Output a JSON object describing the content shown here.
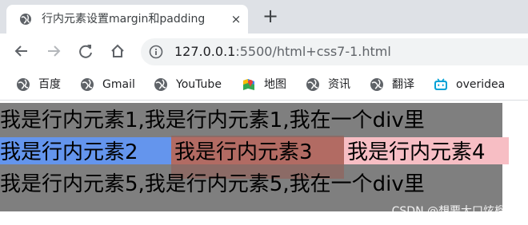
{
  "tab": {
    "title": "行内元素设置margin和padding",
    "close_glyph": "×"
  },
  "newtab_glyph": "+",
  "address_bar": {
    "host": "127.0.0.1",
    "rest": ":5500/html+css7-1.html"
  },
  "bookmarks": [
    {
      "label": "百度",
      "icon": "globe-icon"
    },
    {
      "label": "Gmail",
      "icon": "globe-icon"
    },
    {
      "label": "YouTube",
      "icon": "globe-icon"
    },
    {
      "label": "地图",
      "icon": "maps-icon"
    },
    {
      "label": "资讯",
      "icon": "globe-icon"
    },
    {
      "label": "翻译",
      "icon": "globe-icon"
    },
    {
      "label": "overidea",
      "icon": "bilibili-icon"
    }
  ],
  "page": {
    "line1": "我是行内元素1,我是行内元素1,我在一个div里",
    "span2": "我是行内元素2",
    "span3": "我是行内元素3",
    "span4": "我是行内元素4",
    "line3": "我是行内元素5,我是行内元素5,我在一个div里"
  },
  "watermark": "CSDN @想要大口炫榴莲",
  "colors": {
    "outer_bg": "#7f7f7f",
    "span2_bg": "#6495ed",
    "span3_bg": "#b26b63",
    "span4_bg": "#f7bec4"
  }
}
